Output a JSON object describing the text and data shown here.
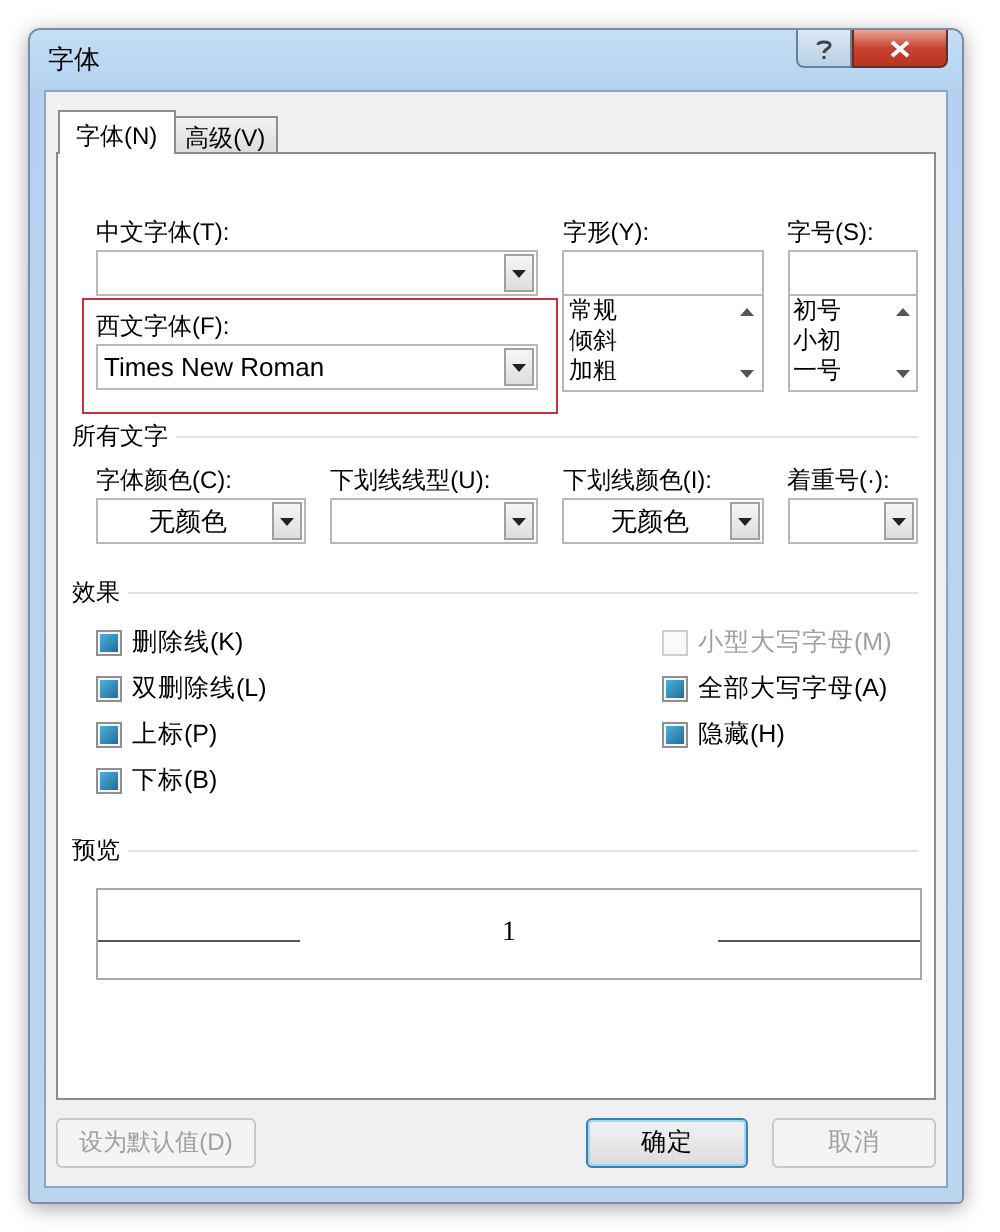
{
  "window": {
    "title": "字体"
  },
  "tabs": [
    {
      "label": "字体(N)",
      "selected": true
    },
    {
      "label": "高级(V)",
      "selected": false
    }
  ],
  "chinese_font": {
    "label": "中文字体(T):"
  },
  "western_font": {
    "label": "西文字体(F):",
    "value": "Times New Roman",
    "highlighted": true
  },
  "font_style": {
    "label": "字形(Y):",
    "options": [
      "常规",
      "倾斜",
      "加粗"
    ]
  },
  "font_size": {
    "label": "字号(S):",
    "options": [
      "初号",
      "小初",
      "一号"
    ]
  },
  "all_text": {
    "heading": "所有文字",
    "fields": [
      {
        "label": "字体颜色(C):",
        "value": "无颜色"
      },
      {
        "label": "下划线线型(U):"
      },
      {
        "label": "下划线颜色(I):",
        "value": "无颜色"
      },
      {
        "label": "着重号(·):"
      }
    ]
  },
  "effects": {
    "heading": "效果",
    "columns": [
      [
        {
          "label": "删除线(K)",
          "indeterminate": true,
          "disabled": false
        },
        {
          "label": "双删除线(L)",
          "indeterminate": true,
          "disabled": false
        },
        {
          "label": "上标(P)",
          "indeterminate": true,
          "disabled": false
        },
        {
          "label": "下标(B)",
          "indeterminate": true,
          "disabled": false
        }
      ],
      [
        {
          "label": "小型大写字母(M)",
          "indeterminate": false,
          "disabled": true
        },
        {
          "label": "全部大写字母(A)",
          "indeterminate": true,
          "disabled": false
        },
        {
          "label": "隐藏(H)",
          "indeterminate": true,
          "disabled": false
        }
      ]
    ]
  },
  "preview": {
    "heading": "预览",
    "sample": "1"
  },
  "buttons": [
    {
      "label": "设为默认值(D)",
      "disabled": true,
      "default": false
    },
    {
      "label": "确定",
      "disabled": false,
      "default": true
    },
    {
      "label": "取消",
      "disabled": true,
      "default": false
    }
  ]
}
